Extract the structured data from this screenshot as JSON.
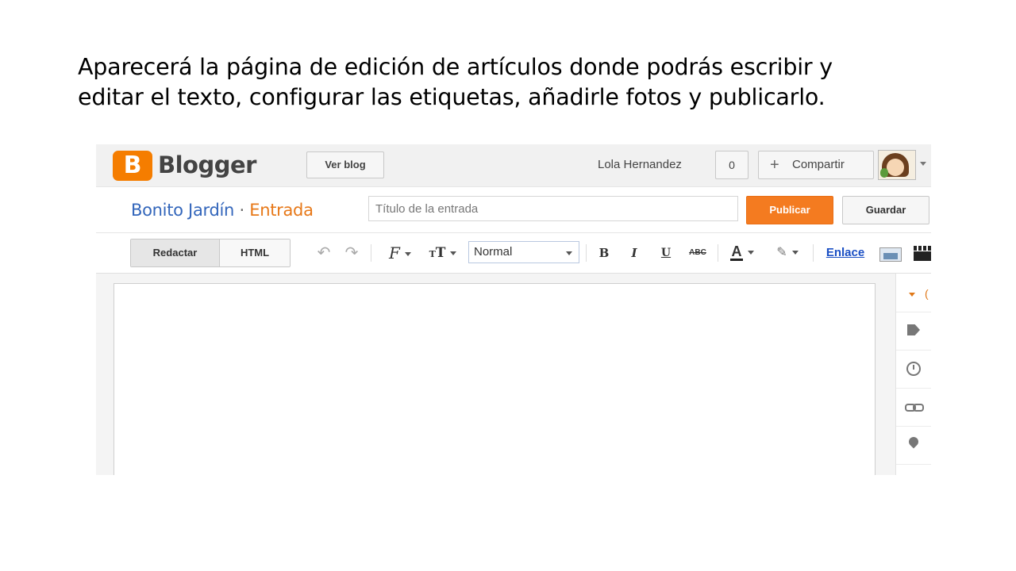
{
  "caption": {
    "line1": "Aparecerá la página de edición de artículos donde podrás escribir y",
    "line2": "editar el texto, configurar las etiquetas, añadirle fotos y publicarlo."
  },
  "topbar": {
    "logo_letter": "B",
    "logo_text": "Blogger",
    "view_blog_label": "Ver blog",
    "user_name": "Lola Hernandez",
    "notification_count": "0",
    "share_plus": "+",
    "share_label": "Compartir"
  },
  "postbar": {
    "blog_name": "Bonito Jardín",
    "separator": "·",
    "section": "Entrada",
    "title_placeholder": "Título de la entrada",
    "publish_label": "Publicar",
    "save_label": "Guardar"
  },
  "toolbar": {
    "compose_label": "Redactar",
    "html_label": "HTML",
    "undo_glyph": "↶",
    "redo_glyph": "↷",
    "font_glyph": "F",
    "size_glyph_small": "T",
    "size_glyph_big": "T",
    "format_value": "Normal",
    "bold_glyph": "B",
    "italic_glyph": "I",
    "underline_glyph": "U",
    "strike_glyph": "ABC",
    "color_glyph": "A",
    "highlight_glyph": "✎",
    "link_label": "Enlace"
  },
  "colors": {
    "accent_orange": "#f47b20",
    "blog_name_blue": "#3366bb",
    "link_blue": "#1a4fc4"
  },
  "icons": [
    "settings-caret-icon",
    "label-tag-icon",
    "schedule-clock-icon",
    "permalink-chain-icon",
    "location-pin-icon",
    "image-icon",
    "video-icon"
  ]
}
